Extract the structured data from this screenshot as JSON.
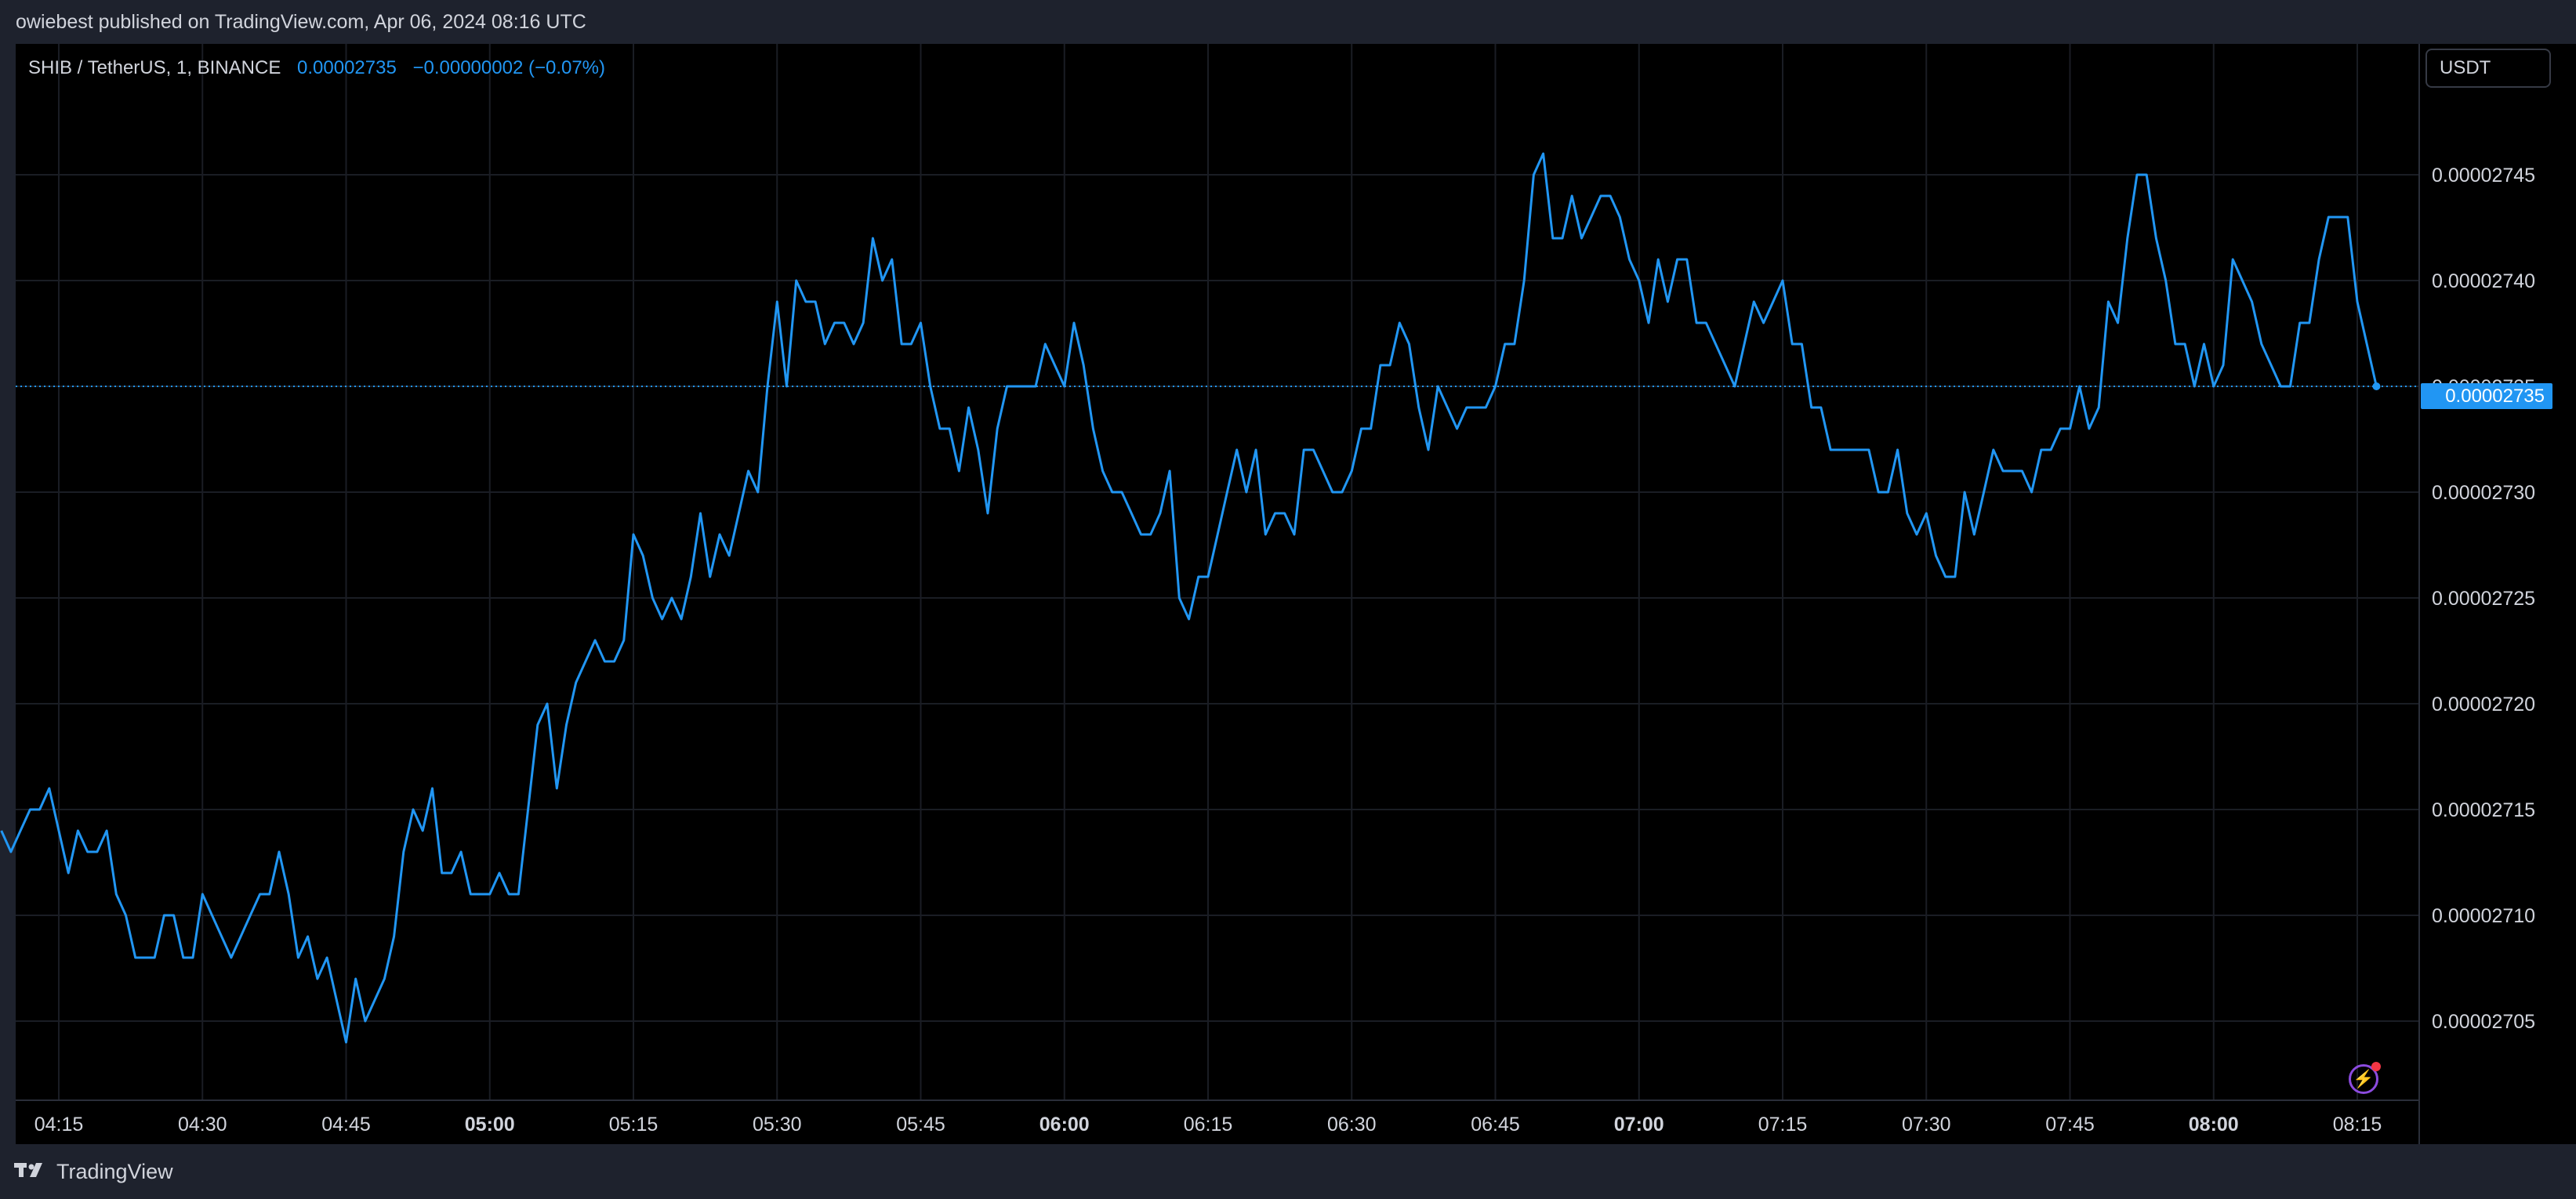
{
  "header": {
    "publisher_text": "owiebest published on TradingView.com, Apr 06, 2024 08:16 UTC"
  },
  "legend": {
    "symbol": "SHIB / TetherUS, 1, BINANCE",
    "last_value": "0.00002735",
    "change": "−0.00000002 (−0.07%)"
  },
  "toolbar": {
    "currency_label": "USDT"
  },
  "last_price_label": "0.00002735",
  "footer": {
    "brand": "TradingView"
  },
  "colors": {
    "background": "#000000",
    "frame": "#1e222d",
    "line": "#2196f3",
    "grid": "#1a1d24",
    "text": "#d1d4dc"
  },
  "icons": {
    "logo": "tradingview-logo-icon",
    "bolt": "lightning-bolt-icon"
  },
  "chart_data": {
    "type": "line",
    "title": "SHIB / TetherUS, 1, BINANCE",
    "xlabel": "",
    "ylabel": "",
    "x_unit": "time (UTC)",
    "x_start": "04:09",
    "x_end": "08:16",
    "y_unit": "USDT",
    "ylim": [
      2.7e-05,
      2.75e-05
    ],
    "grid": true,
    "y_ticks": [
      "0.00002705",
      "0.00002710",
      "0.00002715",
      "0.00002720",
      "0.00002725",
      "0.00002730",
      "0.00002735",
      "0.00002740",
      "0.00002745"
    ],
    "x_ticks": [
      {
        "label": "04:15",
        "time": "04:15",
        "bold": false
      },
      {
        "label": "04:30",
        "time": "04:30",
        "bold": false
      },
      {
        "label": "04:45",
        "time": "04:45",
        "bold": false
      },
      {
        "label": "05:00",
        "time": "05:00",
        "bold": true
      },
      {
        "label": "05:15",
        "time": "05:15",
        "bold": false
      },
      {
        "label": "05:30",
        "time": "05:30",
        "bold": false
      },
      {
        "label": "05:45",
        "time": "05:45",
        "bold": false
      },
      {
        "label": "06:00",
        "time": "06:00",
        "bold": true
      },
      {
        "label": "06:15",
        "time": "06:15",
        "bold": false
      },
      {
        "label": "06:30",
        "time": "06:30",
        "bold": false
      },
      {
        "label": "06:45",
        "time": "06:45",
        "bold": false
      },
      {
        "label": "07:00",
        "time": "07:00",
        "bold": true
      },
      {
        "label": "07:15",
        "time": "07:15",
        "bold": false
      },
      {
        "label": "07:30",
        "time": "07:30",
        "bold": false
      },
      {
        "label": "07:45",
        "time": "07:45",
        "bold": false
      },
      {
        "label": "08:00",
        "time": "08:00",
        "bold": true
      },
      {
        "label": "08:15",
        "time": "08:15",
        "bold": false
      }
    ],
    "last_price": 2.735e-05,
    "series": [
      {
        "points": [
          [
            "04:09",
            2.714e-05
          ],
          [
            "04:10",
            2.713e-05
          ],
          [
            "04:11",
            2.714e-05
          ],
          [
            "04:12",
            2.715e-05
          ],
          [
            "04:13",
            2.715e-05
          ],
          [
            "04:14",
            2.716e-05
          ],
          [
            "04:15",
            2.714e-05
          ],
          [
            "04:16",
            2.712e-05
          ],
          [
            "04:17",
            2.714e-05
          ],
          [
            "04:18",
            2.713e-05
          ],
          [
            "04:19",
            2.713e-05
          ],
          [
            "04:20",
            2.714e-05
          ],
          [
            "04:21",
            2.711e-05
          ],
          [
            "04:22",
            2.71e-05
          ],
          [
            "04:23",
            2.708e-05
          ],
          [
            "04:24",
            2.708e-05
          ],
          [
            "04:25",
            2.708e-05
          ],
          [
            "04:26",
            2.71e-05
          ],
          [
            "04:27",
            2.71e-05
          ],
          [
            "04:28",
            2.708e-05
          ],
          [
            "04:29",
            2.708e-05
          ],
          [
            "04:30",
            2.711e-05
          ],
          [
            "04:31",
            2.71e-05
          ],
          [
            "04:32",
            2.709e-05
          ],
          [
            "04:33",
            2.708e-05
          ],
          [
            "04:34",
            2.709e-05
          ],
          [
            "04:35",
            2.71e-05
          ],
          [
            "04:36",
            2.711e-05
          ],
          [
            "04:37",
            2.711e-05
          ],
          [
            "04:38",
            2.713e-05
          ],
          [
            "04:39",
            2.711e-05
          ],
          [
            "04:40",
            2.708e-05
          ],
          [
            "04:41",
            2.709e-05
          ],
          [
            "04:42",
            2.707e-05
          ],
          [
            "04:43",
            2.708e-05
          ],
          [
            "04:44",
            2.706e-05
          ],
          [
            "04:45",
            2.704e-05
          ],
          [
            "04:46",
            2.707e-05
          ],
          [
            "04:47",
            2.705e-05
          ],
          [
            "04:48",
            2.706e-05
          ],
          [
            "04:49",
            2.707e-05
          ],
          [
            "04:50",
            2.709e-05
          ],
          [
            "04:51",
            2.713e-05
          ],
          [
            "04:52",
            2.715e-05
          ],
          [
            "04:53",
            2.714e-05
          ],
          [
            "04:54",
            2.716e-05
          ],
          [
            "04:55",
            2.712e-05
          ],
          [
            "04:56",
            2.712e-05
          ],
          [
            "04:57",
            2.713e-05
          ],
          [
            "04:58",
            2.711e-05
          ],
          [
            "04:59",
            2.711e-05
          ],
          [
            "05:00",
            2.711e-05
          ],
          [
            "05:01",
            2.712e-05
          ],
          [
            "05:02",
            2.711e-05
          ],
          [
            "05:03",
            2.711e-05
          ],
          [
            "05:04",
            2.715e-05
          ],
          [
            "05:05",
            2.719e-05
          ],
          [
            "05:06",
            2.72e-05
          ],
          [
            "05:07",
            2.716e-05
          ],
          [
            "05:08",
            2.719e-05
          ],
          [
            "05:09",
            2.721e-05
          ],
          [
            "05:10",
            2.722e-05
          ],
          [
            "05:11",
            2.723e-05
          ],
          [
            "05:12",
            2.722e-05
          ],
          [
            "05:13",
            2.722e-05
          ],
          [
            "05:14",
            2.723e-05
          ],
          [
            "05:15",
            2.728e-05
          ],
          [
            "05:16",
            2.727e-05
          ],
          [
            "05:17",
            2.725e-05
          ],
          [
            "05:18",
            2.724e-05
          ],
          [
            "05:19",
            2.725e-05
          ],
          [
            "05:20",
            2.724e-05
          ],
          [
            "05:21",
            2.726e-05
          ],
          [
            "05:22",
            2.729e-05
          ],
          [
            "05:23",
            2.726e-05
          ],
          [
            "05:24",
            2.728e-05
          ],
          [
            "05:25",
            2.727e-05
          ],
          [
            "05:26",
            2.729e-05
          ],
          [
            "05:27",
            2.731e-05
          ],
          [
            "05:28",
            2.73e-05
          ],
          [
            "05:29",
            2.735e-05
          ],
          [
            "05:30",
            2.739e-05
          ],
          [
            "05:31",
            2.735e-05
          ],
          [
            "05:32",
            2.74e-05
          ],
          [
            "05:33",
            2.739e-05
          ],
          [
            "05:34",
            2.739e-05
          ],
          [
            "05:35",
            2.737e-05
          ],
          [
            "05:36",
            2.738e-05
          ],
          [
            "05:37",
            2.738e-05
          ],
          [
            "05:38",
            2.737e-05
          ],
          [
            "05:39",
            2.738e-05
          ],
          [
            "05:40",
            2.742e-05
          ],
          [
            "05:41",
            2.74e-05
          ],
          [
            "05:42",
            2.741e-05
          ],
          [
            "05:43",
            2.737e-05
          ],
          [
            "05:44",
            2.737e-05
          ],
          [
            "05:45",
            2.738e-05
          ],
          [
            "05:46",
            2.735e-05
          ],
          [
            "05:47",
            2.733e-05
          ],
          [
            "05:48",
            2.733e-05
          ],
          [
            "05:49",
            2.731e-05
          ],
          [
            "05:50",
            2.734e-05
          ],
          [
            "05:51",
            2.732e-05
          ],
          [
            "05:52",
            2.729e-05
          ],
          [
            "05:53",
            2.733e-05
          ],
          [
            "05:54",
            2.735e-05
          ],
          [
            "05:55",
            2.735e-05
          ],
          [
            "05:56",
            2.735e-05
          ],
          [
            "05:57",
            2.735e-05
          ],
          [
            "05:58",
            2.737e-05
          ],
          [
            "05:59",
            2.736e-05
          ],
          [
            "06:00",
            2.735e-05
          ],
          [
            "06:01",
            2.738e-05
          ],
          [
            "06:02",
            2.736e-05
          ],
          [
            "06:03",
            2.733e-05
          ],
          [
            "06:04",
            2.731e-05
          ],
          [
            "06:05",
            2.73e-05
          ],
          [
            "06:06",
            2.73e-05
          ],
          [
            "06:07",
            2.729e-05
          ],
          [
            "06:08",
            2.728e-05
          ],
          [
            "06:09",
            2.728e-05
          ],
          [
            "06:10",
            2.729e-05
          ],
          [
            "06:11",
            2.731e-05
          ],
          [
            "06:12",
            2.725e-05
          ],
          [
            "06:13",
            2.724e-05
          ],
          [
            "06:14",
            2.726e-05
          ],
          [
            "06:15",
            2.726e-05
          ],
          [
            "06:16",
            2.728e-05
          ],
          [
            "06:17",
            2.73e-05
          ],
          [
            "06:18",
            2.732e-05
          ],
          [
            "06:19",
            2.73e-05
          ],
          [
            "06:20",
            2.732e-05
          ],
          [
            "06:21",
            2.728e-05
          ],
          [
            "06:22",
            2.729e-05
          ],
          [
            "06:23",
            2.729e-05
          ],
          [
            "06:24",
            2.728e-05
          ],
          [
            "06:25",
            2.732e-05
          ],
          [
            "06:26",
            2.732e-05
          ],
          [
            "06:27",
            2.731e-05
          ],
          [
            "06:28",
            2.73e-05
          ],
          [
            "06:29",
            2.73e-05
          ],
          [
            "06:30",
            2.731e-05
          ],
          [
            "06:31",
            2.733e-05
          ],
          [
            "06:32",
            2.733e-05
          ],
          [
            "06:33",
            2.736e-05
          ],
          [
            "06:34",
            2.736e-05
          ],
          [
            "06:35",
            2.738e-05
          ],
          [
            "06:36",
            2.737e-05
          ],
          [
            "06:37",
            2.734e-05
          ],
          [
            "06:38",
            2.732e-05
          ],
          [
            "06:39",
            2.735e-05
          ],
          [
            "06:40",
            2.734e-05
          ],
          [
            "06:41",
            2.733e-05
          ],
          [
            "06:42",
            2.734e-05
          ],
          [
            "06:43",
            2.734e-05
          ],
          [
            "06:44",
            2.734e-05
          ],
          [
            "06:45",
            2.735e-05
          ],
          [
            "06:46",
            2.737e-05
          ],
          [
            "06:47",
            2.737e-05
          ],
          [
            "06:48",
            2.74e-05
          ],
          [
            "06:49",
            2.745e-05
          ],
          [
            "06:50",
            2.746e-05
          ],
          [
            "06:51",
            2.742e-05
          ],
          [
            "06:52",
            2.742e-05
          ],
          [
            "06:53",
            2.744e-05
          ],
          [
            "06:54",
            2.742e-05
          ],
          [
            "06:55",
            2.743e-05
          ],
          [
            "06:56",
            2.744e-05
          ],
          [
            "06:57",
            2.744e-05
          ],
          [
            "06:58",
            2.743e-05
          ],
          [
            "06:59",
            2.741e-05
          ],
          [
            "07:00",
            2.74e-05
          ],
          [
            "07:01",
            2.738e-05
          ],
          [
            "07:02",
            2.741e-05
          ],
          [
            "07:03",
            2.739e-05
          ],
          [
            "07:04",
            2.741e-05
          ],
          [
            "07:05",
            2.741e-05
          ],
          [
            "07:06",
            2.738e-05
          ],
          [
            "07:07",
            2.738e-05
          ],
          [
            "07:08",
            2.737e-05
          ],
          [
            "07:09",
            2.736e-05
          ],
          [
            "07:10",
            2.735e-05
          ],
          [
            "07:11",
            2.737e-05
          ],
          [
            "07:12",
            2.739e-05
          ],
          [
            "07:13",
            2.738e-05
          ],
          [
            "07:14",
            2.739e-05
          ],
          [
            "07:15",
            2.74e-05
          ],
          [
            "07:16",
            2.737e-05
          ],
          [
            "07:17",
            2.737e-05
          ],
          [
            "07:18",
            2.734e-05
          ],
          [
            "07:19",
            2.734e-05
          ],
          [
            "07:20",
            2.732e-05
          ],
          [
            "07:21",
            2.732e-05
          ],
          [
            "07:22",
            2.732e-05
          ],
          [
            "07:23",
            2.732e-05
          ],
          [
            "07:24",
            2.732e-05
          ],
          [
            "07:25",
            2.73e-05
          ],
          [
            "07:26",
            2.73e-05
          ],
          [
            "07:27",
            2.732e-05
          ],
          [
            "07:28",
            2.729e-05
          ],
          [
            "07:29",
            2.728e-05
          ],
          [
            "07:30",
            2.729e-05
          ],
          [
            "07:31",
            2.727e-05
          ],
          [
            "07:32",
            2.726e-05
          ],
          [
            "07:33",
            2.726e-05
          ],
          [
            "07:34",
            2.73e-05
          ],
          [
            "07:35",
            2.728e-05
          ],
          [
            "07:36",
            2.73e-05
          ],
          [
            "07:37",
            2.732e-05
          ],
          [
            "07:38",
            2.731e-05
          ],
          [
            "07:39",
            2.731e-05
          ],
          [
            "07:40",
            2.731e-05
          ],
          [
            "07:41",
            2.73e-05
          ],
          [
            "07:42",
            2.732e-05
          ],
          [
            "07:43",
            2.732e-05
          ],
          [
            "07:44",
            2.733e-05
          ],
          [
            "07:45",
            2.733e-05
          ],
          [
            "07:46",
            2.735e-05
          ],
          [
            "07:47",
            2.733e-05
          ],
          [
            "07:48",
            2.734e-05
          ],
          [
            "07:49",
            2.739e-05
          ],
          [
            "07:50",
            2.738e-05
          ],
          [
            "07:51",
            2.742e-05
          ],
          [
            "07:52",
            2.745e-05
          ],
          [
            "07:53",
            2.745e-05
          ],
          [
            "07:54",
            2.742e-05
          ],
          [
            "07:55",
            2.74e-05
          ],
          [
            "07:56",
            2.737e-05
          ],
          [
            "07:57",
            2.737e-05
          ],
          [
            "07:58",
            2.735e-05
          ],
          [
            "07:59",
            2.737e-05
          ],
          [
            "08:00",
            2.735e-05
          ],
          [
            "08:01",
            2.736e-05
          ],
          [
            "08:02",
            2.741e-05
          ],
          [
            "08:03",
            2.74e-05
          ],
          [
            "08:04",
            2.739e-05
          ],
          [
            "08:05",
            2.737e-05
          ],
          [
            "08:06",
            2.736e-05
          ],
          [
            "08:07",
            2.735e-05
          ],
          [
            "08:08",
            2.735e-05
          ],
          [
            "08:09",
            2.738e-05
          ],
          [
            "08:10",
            2.738e-05
          ],
          [
            "08:11",
            2.741e-05
          ],
          [
            "08:12",
            2.743e-05
          ],
          [
            "08:13",
            2.743e-05
          ],
          [
            "08:14",
            2.743e-05
          ],
          [
            "08:15",
            2.739e-05
          ],
          [
            "08:16",
            2.737e-05
          ],
          [
            "08:17",
            2.735e-05
          ]
        ]
      }
    ]
  }
}
